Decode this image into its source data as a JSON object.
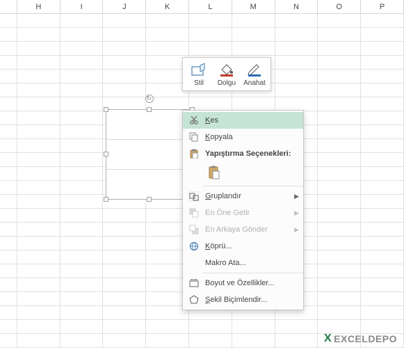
{
  "columns": [
    "H",
    "I",
    "J",
    "K",
    "L",
    "M",
    "N",
    "O",
    "P"
  ],
  "miniToolbar": {
    "style": "Stil",
    "fill": "Dolgu",
    "outline": "Anahat"
  },
  "menu": {
    "cut": "Kes",
    "copy": "Kopyala",
    "pasteOptions": "Yapıştırma Seçenekleri:",
    "group": "Gruplandır",
    "bringFront": "En Öne Getir",
    "sendBack": "En Arkaya Gönder",
    "hyperlink": "Köprü...",
    "assignMacro": "Makro Ata...",
    "sizeProps": "Boyut ve Özellikler...",
    "formatShape": "Şekil Biçimlendir..."
  },
  "watermark": "EXCELDEPO"
}
